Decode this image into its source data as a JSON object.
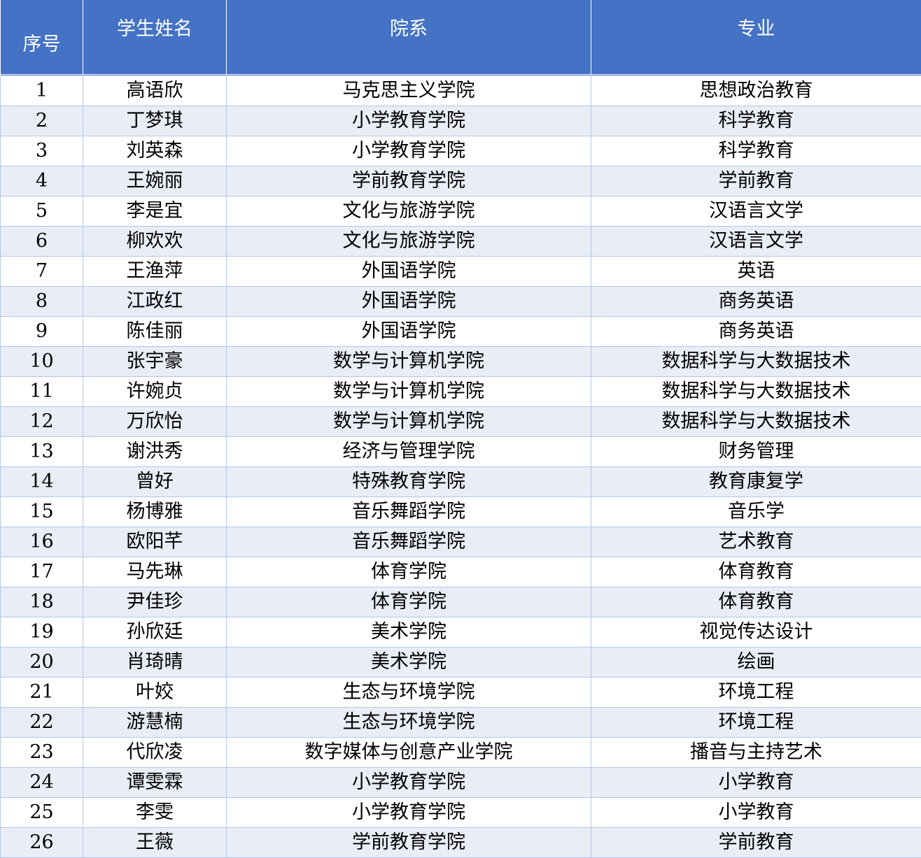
{
  "table": {
    "headers": [
      "序号",
      "学生姓名",
      "院系",
      "专业"
    ],
    "rows": [
      [
        "1",
        "高语欣",
        "马克思主义学院",
        "思想政治教育"
      ],
      [
        "2",
        "丁梦琪",
        "小学教育学院",
        "科学教育"
      ],
      [
        "3",
        "刘英森",
        "小学教育学院",
        "科学教育"
      ],
      [
        "4",
        "王婉丽",
        "学前教育学院",
        "学前教育"
      ],
      [
        "5",
        "李是宜",
        "文化与旅游学院",
        "汉语言文学"
      ],
      [
        "6",
        "柳欢欢",
        "文化与旅游学院",
        "汉语言文学"
      ],
      [
        "7",
        "王渔萍",
        "外国语学院",
        "英语"
      ],
      [
        "8",
        "江政红",
        "外国语学院",
        "商务英语"
      ],
      [
        "9",
        "陈佳丽",
        "外国语学院",
        "商务英语"
      ],
      [
        "10",
        "张宇豪",
        "数学与计算机学院",
        "数据科学与大数据技术"
      ],
      [
        "11",
        "许婉贞",
        "数学与计算机学院",
        "数据科学与大数据技术"
      ],
      [
        "12",
        "万欣怡",
        "数学与计算机学院",
        "数据科学与大数据技术"
      ],
      [
        "13",
        "谢洪秀",
        "经济与管理学院",
        "财务管理"
      ],
      [
        "14",
        "曾好",
        "特殊教育学院",
        "教育康复学"
      ],
      [
        "15",
        "杨博雅",
        "音乐舞蹈学院",
        "音乐学"
      ],
      [
        "16",
        "欧阳芊",
        "音乐舞蹈学院",
        "艺术教育"
      ],
      [
        "17",
        "马先琳",
        "体育学院",
        "体育教育"
      ],
      [
        "18",
        "尹佳珍",
        "体育学院",
        "体育教育"
      ],
      [
        "19",
        "孙欣廷",
        "美术学院",
        "视觉传达设计"
      ],
      [
        "20",
        "肖琦晴",
        "美术学院",
        "绘画"
      ],
      [
        "21",
        "叶姣",
        "生态与环境学院",
        "环境工程"
      ],
      [
        "22",
        "游慧楠",
        "生态与环境学院",
        "环境工程"
      ],
      [
        "23",
        "代欣凌",
        "数字媒体与创意产业学院",
        "播音与主持艺术"
      ],
      [
        "24",
        "谭雯霖",
        "小学教育学院",
        "小学教育"
      ],
      [
        "25",
        "李雯",
        "小学教育学院",
        "小学教育"
      ],
      [
        "26",
        "王薇",
        "学前教育学院",
        "学前教育"
      ]
    ]
  },
  "colors": {
    "header_bg": "#4472c4",
    "header_text": "#ffffff",
    "band_bg": "#e9edf6",
    "grid": "#b4c6e7"
  }
}
